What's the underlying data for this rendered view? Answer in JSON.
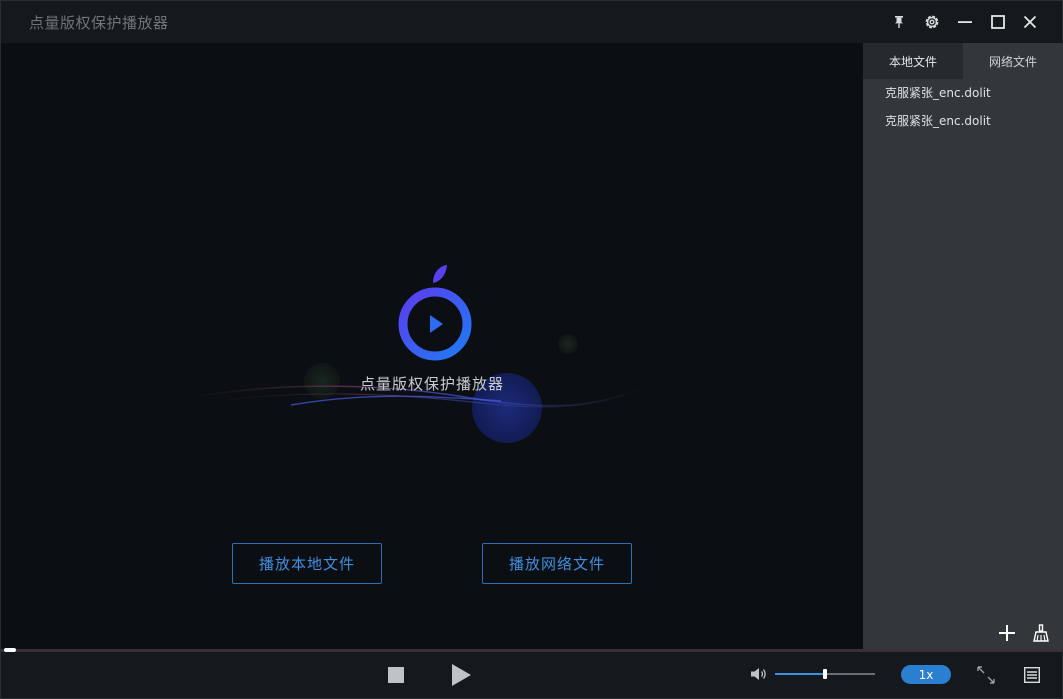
{
  "window": {
    "title": "点量版权保护播放器"
  },
  "title_controls": {
    "pin_icon": "pin-icon",
    "settings_icon": "gear-icon",
    "minimize_icon": "minimize-icon",
    "maximize_icon": "maximize-icon",
    "close_icon": "close-icon"
  },
  "splash": {
    "logo_icon": "player-logo-icon",
    "title": "点量版权保护播放器",
    "accent_color": "#2b6cf0"
  },
  "actions": {
    "play_local_label": "播放本地文件",
    "play_network_label": "播放网络文件"
  },
  "sidebar": {
    "tabs": [
      {
        "label": "本地文件",
        "active": true
      },
      {
        "label": "网络文件",
        "active": false
      }
    ],
    "files": [
      {
        "name": "克服紧张_enc.dolit"
      },
      {
        "name": "克服紧张_enc.dolit"
      }
    ],
    "add_icon": "plus-icon",
    "clear_icon": "broom-icon"
  },
  "player": {
    "progress": 0.0,
    "stop_icon": "stop-icon",
    "play_icon": "play-icon",
    "volume_icon": "volume-icon",
    "volume": 0.5,
    "speed_label": "1x",
    "fullscreen_icon": "fullscreen-icon",
    "playlist_icon": "playlist-icon",
    "accent_color": "#2a7fd0"
  }
}
